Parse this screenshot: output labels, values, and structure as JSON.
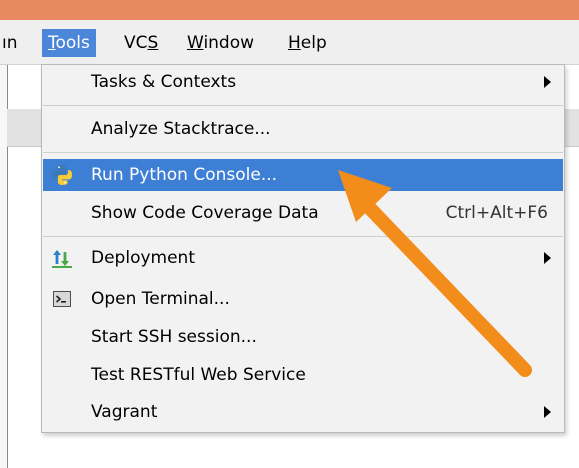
{
  "menubar": {
    "items": [
      {
        "text": "ın",
        "mnemonic": ""
      },
      {
        "text": "Tools",
        "mnemonic": "T"
      },
      {
        "text": "VCS",
        "mnemonic": "S"
      },
      {
        "text": "Window",
        "mnemonic": "W"
      },
      {
        "text": "Help",
        "mnemonic": "H"
      }
    ],
    "active": "Tools"
  },
  "menu": {
    "items": [
      {
        "label": "Tasks & Contexts",
        "submenu": true
      },
      {
        "label": "Analyze Stacktrace...",
        "submenu": false
      },
      {
        "label": "Run Python Console...",
        "selected": true,
        "icon": "python-icon"
      },
      {
        "label": "Show Code Coverage Data",
        "shortcut": "Ctrl+Alt+F6"
      },
      {
        "label": "Deployment",
        "submenu": true,
        "icon": "deployment-icon"
      },
      {
        "label": "Open Terminal...",
        "icon": "terminal-icon"
      },
      {
        "label": "Start SSH session..."
      },
      {
        "label": "Test RESTful Web Service"
      },
      {
        "label": "Vagrant",
        "submenu": true
      }
    ]
  },
  "colors": {
    "titlebar": "#e9895f",
    "selection": "#3e7fd6",
    "arrow": "#f28c1a"
  },
  "annotation": {
    "type": "arrow",
    "color": "#f28c1a",
    "points_to": "Run Python Console..."
  }
}
